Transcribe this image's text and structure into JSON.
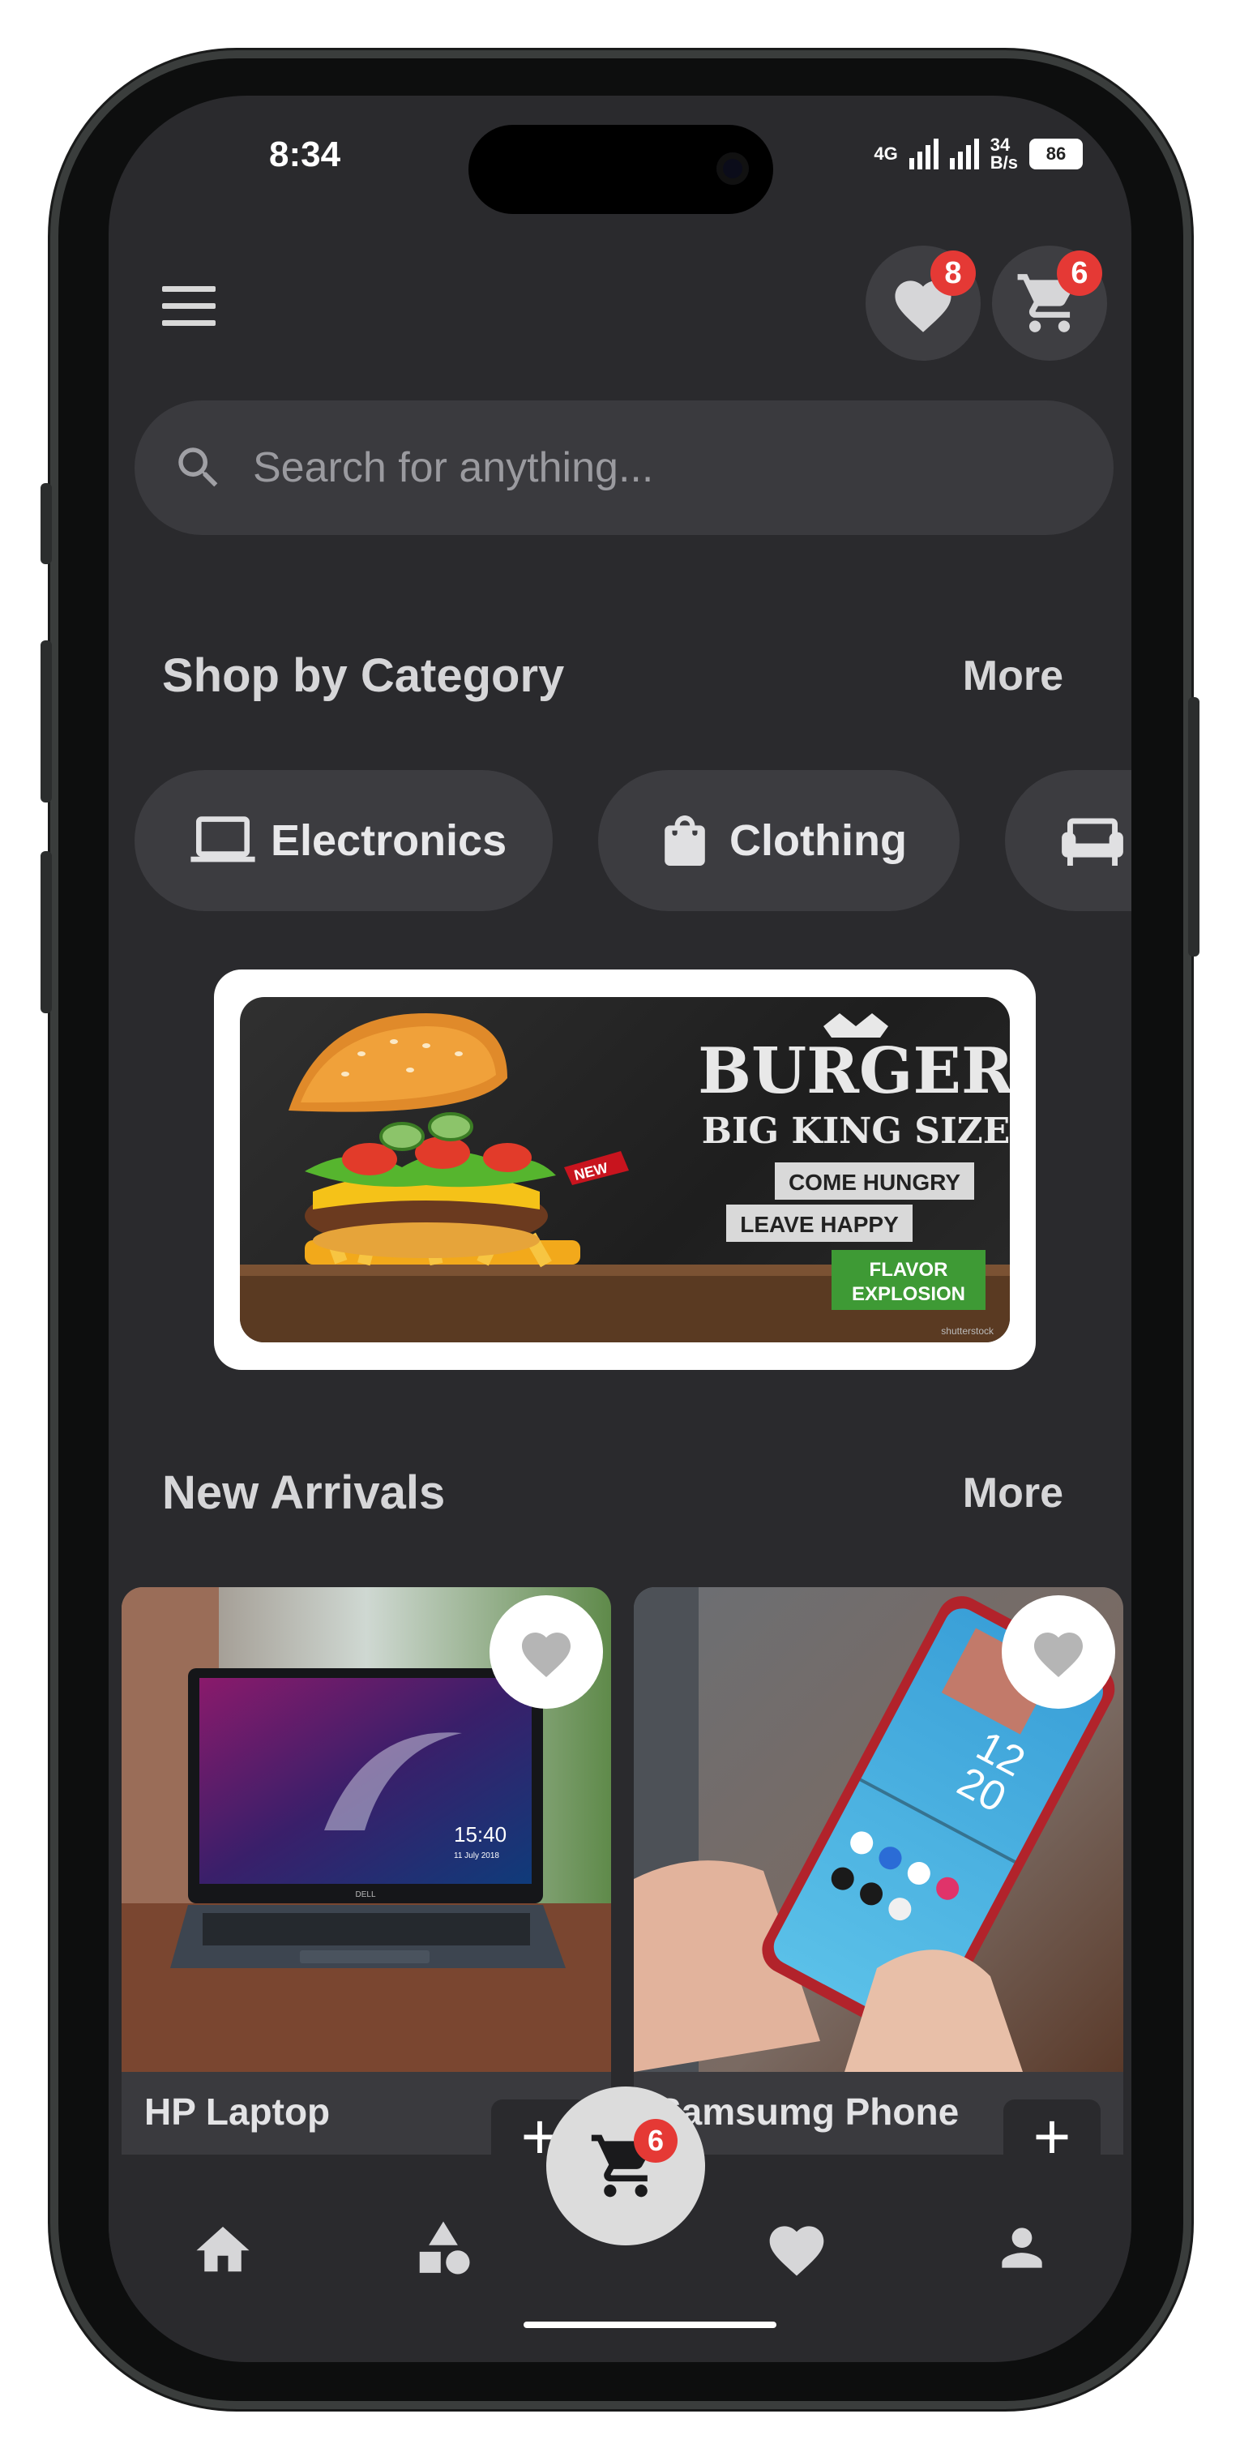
{
  "status_bar": {
    "time": "8:34",
    "network": "4G",
    "speed_value": "34",
    "speed_unit": "B/s",
    "battery": "86"
  },
  "header": {
    "wishlist_count": "8",
    "cart_count": "6"
  },
  "search": {
    "placeholder": "Search for anything..."
  },
  "categories_section": {
    "title": "Shop by Category",
    "more_label": "More",
    "items": [
      {
        "label": "Electronics",
        "icon": "laptop-icon"
      },
      {
        "label": "Clothing",
        "icon": "shopping-bag-icon"
      },
      {
        "label": "",
        "icon": "sofa-icon"
      }
    ]
  },
  "banner": {
    "headline": "BURGER",
    "subhead": "BIG KING SIZE",
    "line1": "COME HUNGRY",
    "line2": "LEAVE HAPPY",
    "tag": "NEW",
    "badge_line1": "FLAVOR",
    "badge_line2": "EXPLOSION",
    "credit": "shutterstock"
  },
  "new_arrivals": {
    "title": "New Arrivals",
    "more_label": "More",
    "products": [
      {
        "name": "HP Laptop",
        "screen_time": "15:40",
        "screen_date": "11 July 2018",
        "brand": "DELL"
      },
      {
        "name": "Samsumg Phone",
        "screen_time_h": "12",
        "screen_time_m": "20"
      }
    ]
  },
  "bottom_nav": {
    "items": [
      "home-icon",
      "categories-icon",
      "cart-icon",
      "heart-icon",
      "profile-icon"
    ],
    "cart_count": "6"
  },
  "colors": {
    "background": "#2a2a2d",
    "surface": "#3a3a3e",
    "badge": "#e53935",
    "text": "#d6d6d8"
  }
}
